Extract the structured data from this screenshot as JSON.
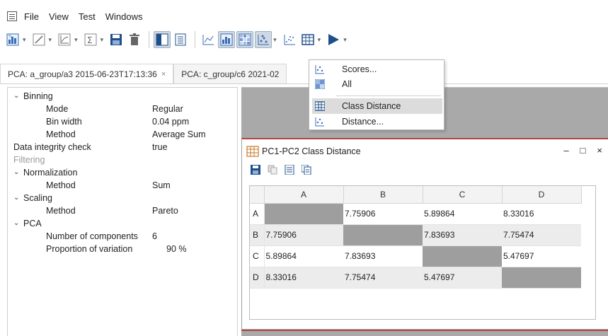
{
  "menu": {
    "items": [
      "File",
      "View",
      "Test",
      "Windows"
    ]
  },
  "toolbar": {
    "icons": [
      "pca-chart-icon",
      "line-icon",
      "xy-plot-icon",
      "sigma-icon",
      "save-icon",
      "trash-icon",
      "panel-icon",
      "document-icon",
      "line-chart-icon",
      "bar-chart-icon",
      "heatmap-icon",
      "scores-icon",
      "scatter-icon",
      "table-icon",
      "play-icon"
    ]
  },
  "tabs": [
    {
      "label": "PCA: a_group/a3 2015-06-23T17:13:36",
      "close": "×"
    },
    {
      "label": "PCA: c_group/c6 2021-02"
    }
  ],
  "properties": {
    "binning": {
      "label": "Binning"
    },
    "mode": {
      "label": "Mode",
      "value": "Regular"
    },
    "bin_width": {
      "label": "Bin width",
      "value": "0.04 ppm"
    },
    "method": {
      "label": "Method",
      "value": "Average Sum"
    },
    "integrity": {
      "label": "Data integrity check",
      "value": "true"
    },
    "filtering": {
      "label": "Filtering"
    },
    "normalization": {
      "label": "Normalization"
    },
    "norm_method": {
      "label": "Method",
      "value": "Sum"
    },
    "scaling": {
      "label": "Scaling"
    },
    "scaling_method": {
      "label": "Method",
      "value": "Pareto"
    },
    "pca": {
      "label": "PCA"
    },
    "components": {
      "label": "Number of components",
      "value": "6"
    },
    "variation": {
      "label": "Proportion of variation",
      "value": "90 %"
    }
  },
  "inner_window": {
    "title": "PC1-PC2 Class Distance",
    "minimize": "–",
    "maximize": "□",
    "close": "×"
  },
  "table": {
    "columns": [
      "A",
      "B",
      "C",
      "D"
    ],
    "rows": [
      {
        "header": "A",
        "cells": [
          "",
          "7.75906",
          "5.89864",
          "8.33016"
        ]
      },
      {
        "header": "B",
        "cells": [
          "7.75906",
          "",
          "7.83693",
          "7.75474"
        ]
      },
      {
        "header": "C",
        "cells": [
          "5.89864",
          "7.83693",
          "",
          "5.47697"
        ]
      },
      {
        "header": "D",
        "cells": [
          "8.33016",
          "7.75474",
          "5.47697",
          ""
        ]
      }
    ]
  },
  "dropdown": {
    "items": [
      {
        "label": "Scores...",
        "icon": "scores-icon"
      },
      {
        "label": "All",
        "icon": "all-icon"
      },
      {
        "label": "Class Distance",
        "icon": "table-icon"
      },
      {
        "label": "Distance...",
        "icon": "scores-icon"
      }
    ]
  }
}
